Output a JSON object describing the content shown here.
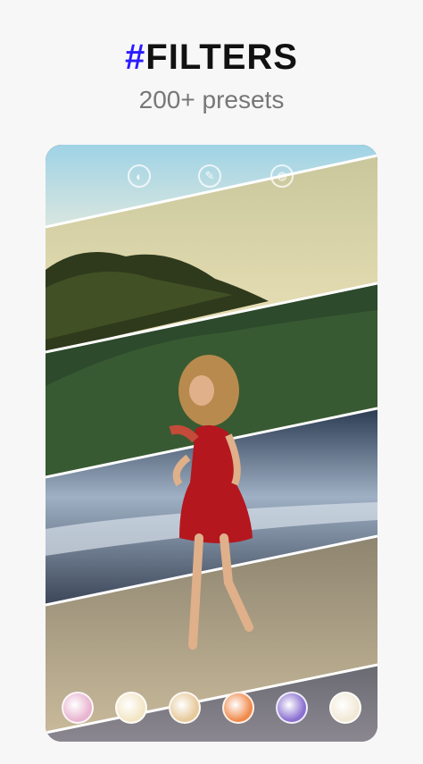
{
  "header": {
    "hash": "#",
    "title": "FILTERS",
    "subtitle": "200+ presets"
  },
  "toolbar": {
    "icons": [
      "contrast-icon",
      "brush-icon",
      "adjust-icon"
    ]
  },
  "filter_swatches": [
    {
      "name": "pink",
      "color": "#e8b4cf"
    },
    {
      "name": "cream",
      "color": "#f3e6c6"
    },
    {
      "name": "sand",
      "color": "#e7c99a"
    },
    {
      "name": "orange",
      "color": "#f08a4b"
    },
    {
      "name": "violet",
      "color": "#8a6fd0"
    },
    {
      "name": "ivory",
      "color": "#f1e9d6"
    }
  ]
}
